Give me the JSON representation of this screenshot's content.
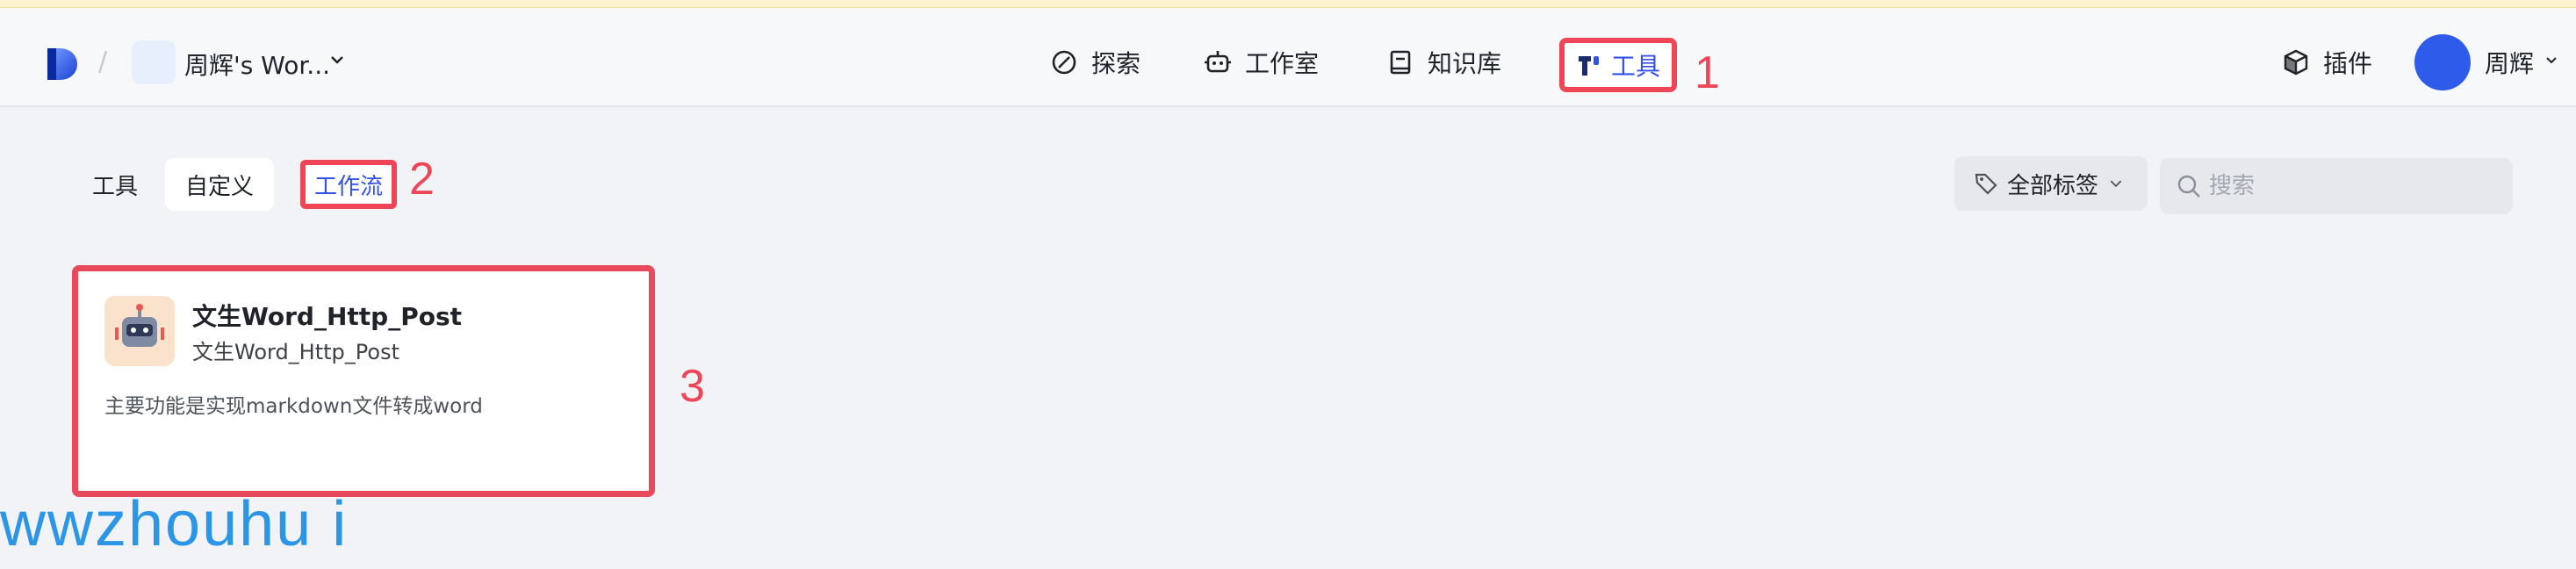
{
  "header": {
    "workspace_name": "周辉's Wor...",
    "nav": {
      "explore": "探索",
      "studio": "工作室",
      "knowledge_base": "知识库",
      "tools": "工具"
    },
    "plugins": "插件",
    "user_name": "周辉"
  },
  "tabs": {
    "tools": "工具",
    "custom": "自定义",
    "workflow": "工作流"
  },
  "filters": {
    "all_tags": "全部标签",
    "search_placeholder": "搜索"
  },
  "card": {
    "title": "文生Word_Http_Post",
    "subtitle": "文生Word_Http_Post",
    "description": "主要功能是实现markdown文件转成word"
  },
  "annotations": {
    "n1": "1",
    "n2": "2",
    "n3": "3"
  },
  "watermark": "wwzhouhu i",
  "colors": {
    "accent_blue": "#3350e8",
    "annotation_red": "#ee4656",
    "watermark_blue": "#2b95e6"
  }
}
